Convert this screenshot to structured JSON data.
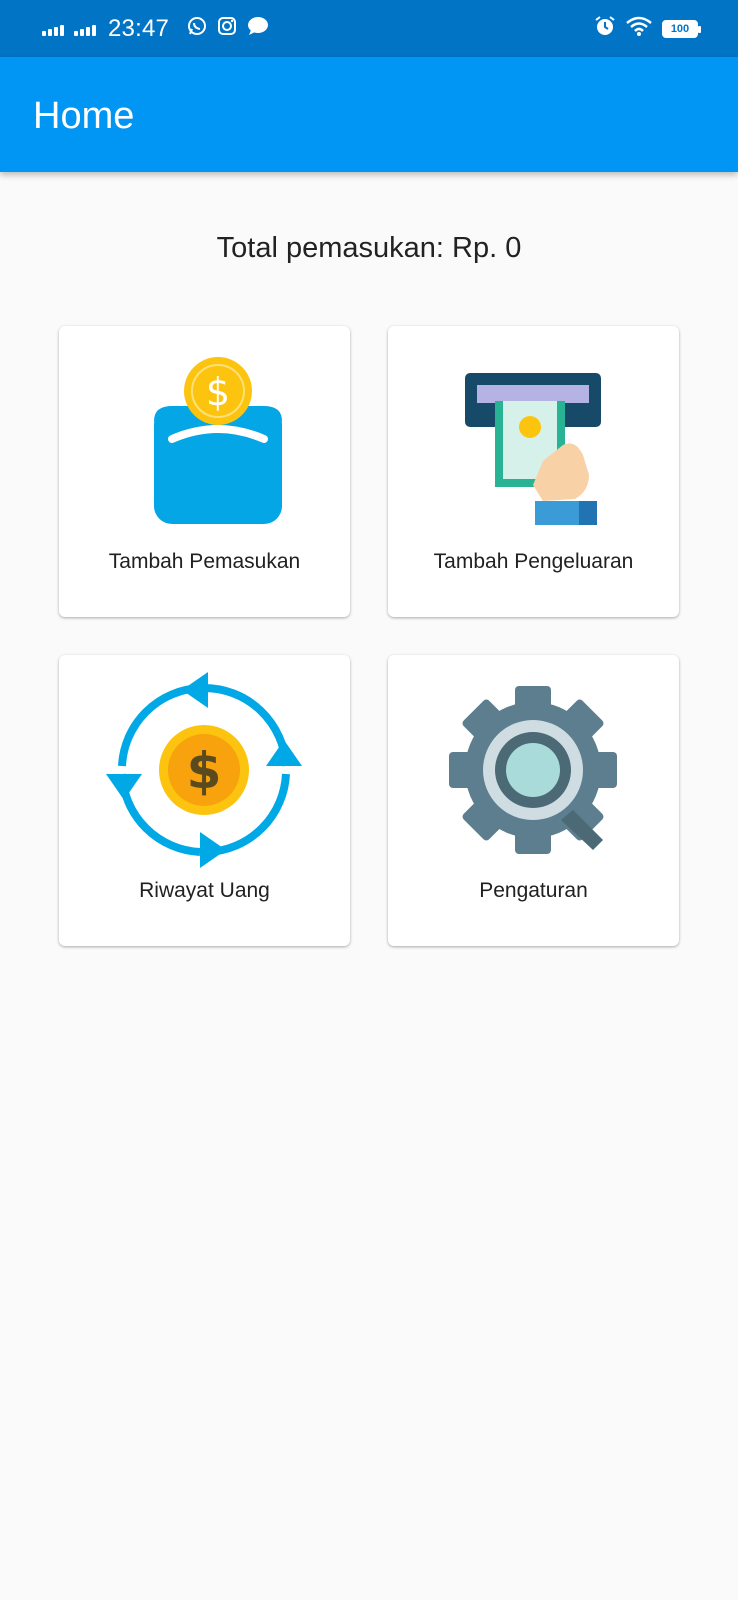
{
  "status_bar": {
    "time": "23:47",
    "battery": "100",
    "icons": [
      "signal-icon",
      "signal-icon",
      "whatsapp-icon",
      "instagram-icon",
      "message-icon",
      "alarm-icon",
      "wifi-icon",
      "battery-icon"
    ]
  },
  "app_bar": {
    "title": "Home"
  },
  "total": {
    "text": "Total pemasukan: Rp. 0"
  },
  "menu": [
    {
      "label": "Tambah Pemasukan",
      "icon": "wallet-coin-icon"
    },
    {
      "label": "Tambah Pengeluaran",
      "icon": "atm-cash-icon"
    },
    {
      "label": "Riwayat Uang",
      "icon": "money-cycle-icon"
    },
    {
      "label": "Pengaturan",
      "icon": "gear-icon"
    }
  ],
  "colors": {
    "status_bar": "#0274c6",
    "app_bar": "#0196f3",
    "background": "#fafafa",
    "card": "#ffffff"
  }
}
